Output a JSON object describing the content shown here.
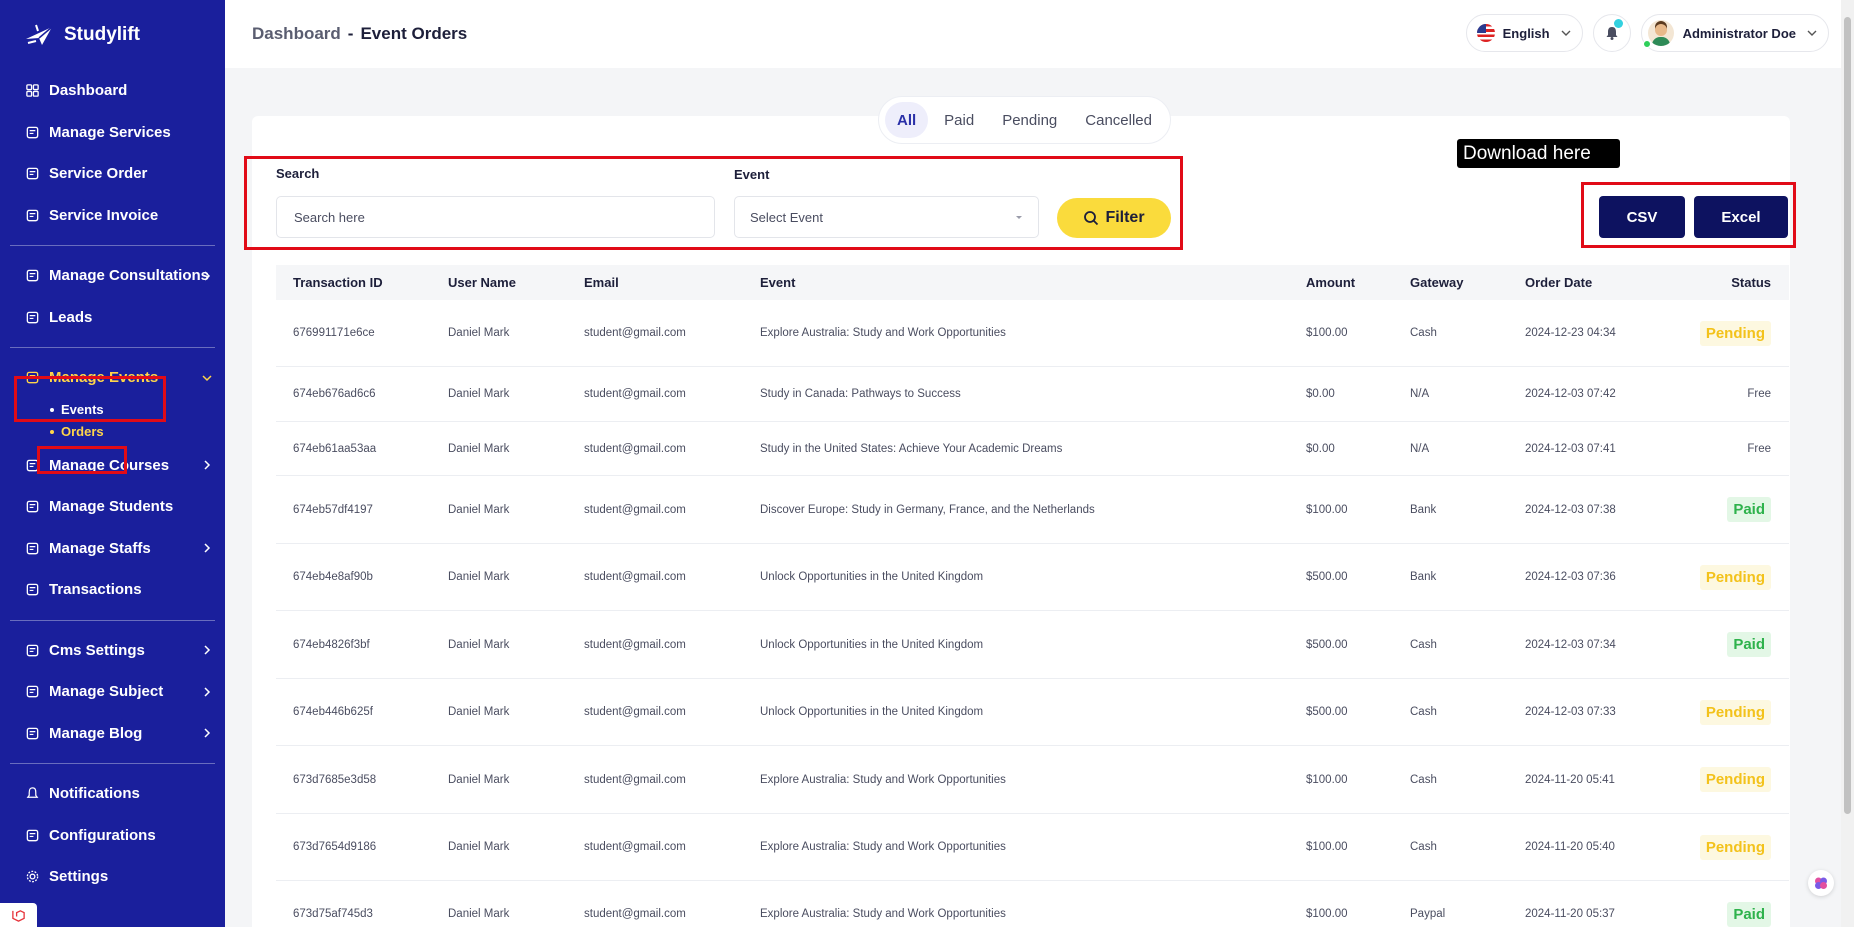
{
  "brand": {
    "name": "Studylift"
  },
  "sidebar": {
    "items": [
      {
        "label": "Dashboard",
        "icon": "dashboard-icon"
      },
      {
        "label": "Manage Services",
        "icon": "services-icon"
      },
      {
        "label": "Service Order",
        "icon": "list-icon"
      },
      {
        "label": "Service Invoice",
        "icon": "invoice-icon"
      },
      {
        "label": "Manage Consultations",
        "icon": "consultation-icon"
      },
      {
        "label": "Leads",
        "icon": "leads-icon"
      },
      {
        "label": "Manage Events",
        "icon": "events-icon"
      },
      {
        "label": "Manage Courses",
        "icon": "courses-icon"
      },
      {
        "label": "Manage Students",
        "icon": "students-icon"
      },
      {
        "label": "Manage Staffs",
        "icon": "staffs-icon"
      },
      {
        "label": "Transactions",
        "icon": "transactions-icon"
      },
      {
        "label": "Cms Settings",
        "icon": "cms-icon"
      },
      {
        "label": "Manage Subject",
        "icon": "subject-icon"
      },
      {
        "label": "Manage Blog",
        "icon": "blog-icon"
      },
      {
        "label": "Notifications",
        "icon": "bell-icon"
      },
      {
        "label": "Configurations",
        "icon": "config-icon"
      },
      {
        "label": "Settings",
        "icon": "gear-icon"
      }
    ],
    "events_sub": [
      {
        "label": "Events"
      },
      {
        "label": "Orders"
      }
    ]
  },
  "header": {
    "crumb_root": "Dashboard",
    "crumb_sep": "-",
    "crumb_page": "Event Orders",
    "language": "English",
    "user_name": "Administrator Doe"
  },
  "tabs": [
    {
      "label": "All"
    },
    {
      "label": "Paid"
    },
    {
      "label": "Pending"
    },
    {
      "label": "Cancelled"
    }
  ],
  "filters": {
    "search_label": "Search",
    "search_placeholder": "Search here",
    "event_label": "Event",
    "event_placeholder": "Select Event",
    "filter_button": "Filter"
  },
  "download": {
    "tooltip": "Download here",
    "csv": "CSV",
    "excel": "Excel"
  },
  "table": {
    "columns": [
      "Transaction ID",
      "User Name",
      "Email",
      "Event",
      "Amount",
      "Gateway",
      "Order Date",
      "Status"
    ],
    "rows": [
      {
        "id": "676991171e6ce",
        "user": "Daniel Mark",
        "email": "student@gmail.com",
        "event": "Explore Australia: Study and Work Opportunities",
        "amount": "$100.00",
        "gateway": "Cash",
        "date": "2024-12-23 04:34",
        "status": "Pending",
        "kind": "pending"
      },
      {
        "id": "674eb676ad6c6",
        "user": "Daniel Mark",
        "email": "student@gmail.com",
        "event": "Study in Canada: Pathways to Success",
        "amount": "$0.00",
        "gateway": "N/A",
        "date": "2024-12-03 07:42",
        "status": "Free",
        "kind": "free"
      },
      {
        "id": "674eb61aa53aa",
        "user": "Daniel Mark",
        "email": "student@gmail.com",
        "event": "Study in the United States: Achieve Your Academic Dreams",
        "amount": "$0.00",
        "gateway": "N/A",
        "date": "2024-12-03 07:41",
        "status": "Free",
        "kind": "free"
      },
      {
        "id": "674eb57df4197",
        "user": "Daniel Mark",
        "email": "student@gmail.com",
        "event": "Discover Europe: Study in Germany, France, and the Netherlands",
        "amount": "$100.00",
        "gateway": "Bank",
        "date": "2024-12-03 07:38",
        "status": "Paid",
        "kind": "paid"
      },
      {
        "id": "674eb4e8af90b",
        "user": "Daniel Mark",
        "email": "student@gmail.com",
        "event": "Unlock Opportunities in the United Kingdom",
        "amount": "$500.00",
        "gateway": "Bank",
        "date": "2024-12-03 07:36",
        "status": "Pending",
        "kind": "pending"
      },
      {
        "id": "674eb4826f3bf",
        "user": "Daniel Mark",
        "email": "student@gmail.com",
        "event": "Unlock Opportunities in the United Kingdom",
        "amount": "$500.00",
        "gateway": "Cash",
        "date": "2024-12-03 07:34",
        "status": "Paid",
        "kind": "paid"
      },
      {
        "id": "674eb446b625f",
        "user": "Daniel Mark",
        "email": "student@gmail.com",
        "event": "Unlock Opportunities in the United Kingdom",
        "amount": "$500.00",
        "gateway": "Cash",
        "date": "2024-12-03 07:33",
        "status": "Pending",
        "kind": "pending"
      },
      {
        "id": "673d7685e3d58",
        "user": "Daniel Mark",
        "email": "student@gmail.com",
        "event": "Explore Australia: Study and Work Opportunities",
        "amount": "$100.00",
        "gateway": "Cash",
        "date": "2024-11-20 05:41",
        "status": "Pending",
        "kind": "pending"
      },
      {
        "id": "673d7654d9186",
        "user": "Daniel Mark",
        "email": "student@gmail.com",
        "event": "Explore Australia: Study and Work Opportunities",
        "amount": "$100.00",
        "gateway": "Cash",
        "date": "2024-11-20 05:40",
        "status": "Pending",
        "kind": "pending"
      },
      {
        "id": "673d75af745d3",
        "user": "Daniel Mark",
        "email": "student@gmail.com",
        "event": "Explore Australia: Study and Work Opportunities",
        "amount": "$100.00",
        "gateway": "Paypal",
        "date": "2024-11-20 05:37",
        "status": "Paid",
        "kind": "paid"
      }
    ]
  },
  "colors": {
    "sidebar_bg": "#1a1f9c",
    "accent_yellow": "#fadb3c",
    "highlight_red": "#e10b17",
    "download_btn": "#0d1260",
    "pending": "#f3c21b",
    "paid": "#2eb24c"
  }
}
